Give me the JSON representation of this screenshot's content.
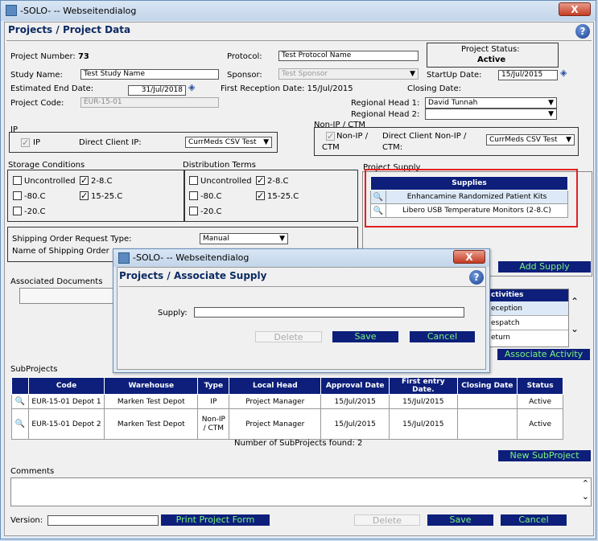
{
  "window": {
    "title": "-SOLO- -- Webseitendialog",
    "close": "X"
  },
  "page": {
    "title": "Projects / Project Data",
    "help": "?"
  },
  "project": {
    "number_label": "Project Number:",
    "number": "73",
    "protocol_label": "Protocol:",
    "protocol": "Test Protocol Name",
    "status_label": "Project Status:",
    "status": "Active",
    "study_name_label": "Study Name:",
    "study_name": "Test Study Name",
    "sponsor_label": "Sponsor:",
    "sponsor": "Test Sponsor",
    "startup_label": "StartUp Date:",
    "startup": "15/Jul/2015",
    "est_end_label": "Estimated End Date:",
    "est_end": "31/Jul/2018",
    "first_reception_label": "First Reception Date:",
    "first_reception": "15/Jul/2015",
    "closing_label": "Closing Date:",
    "code_label": "Project Code:",
    "code": "EUR-15-01",
    "regional_head1_label": "Regional Head 1:",
    "regional_head1": "David Tunnah",
    "regional_head2_label": "Regional Head 2:",
    "regional_head2": ""
  },
  "ip": {
    "section": "IP",
    "ip_label": "IP",
    "direct_client_label": "Direct Client IP:",
    "direct_client": "CurrMeds CSV Test"
  },
  "nonip": {
    "section": "Non-IP / CTM",
    "label_line1": "Non-IP /",
    "label_line2": "CTM",
    "direct_client_line1": "Direct Client Non-IP /",
    "direct_client_line2": "CTM:",
    "direct_client": "CurrMeds CSV Test"
  },
  "storage": {
    "title": "Storage Conditions",
    "options": [
      {
        "label": "Uncontrolled"
      },
      {
        "label": "2-8.C"
      },
      {
        "label": "-80.C"
      },
      {
        "label": "15-25.C"
      },
      {
        "label": "-20.C"
      }
    ]
  },
  "distribution": {
    "title": "Distribution Terms",
    "options": [
      {
        "label": "Uncontrolled"
      },
      {
        "label": "2-8.C"
      },
      {
        "label": "-80.C"
      },
      {
        "label": "15-25.C"
      },
      {
        "label": "-20.C"
      }
    ]
  },
  "shipping": {
    "type_label": "Shipping Order Request Type:",
    "type": "Manual",
    "name_label": "Name of Shipping Order"
  },
  "supply": {
    "section": "Project Supply",
    "header": "Supplies",
    "rows": [
      "Enhancamine Randomized Patient Kits",
      "Libero USB Temperature Monitors (2-8.C)"
    ],
    "add_button": "Add Supply"
  },
  "activities": {
    "header": "ctivities",
    "rows": [
      "eception",
      "espatch",
      "eturn"
    ],
    "button": "Associate Activity"
  },
  "documents": {
    "title": "Associated Documents"
  },
  "subprojects": {
    "title": "SubProjects",
    "headers": [
      "Code",
      "Warehouse",
      "Type",
      "Local Head",
      "Approval Date",
      "First entry Date.",
      "Closing Date",
      "Status"
    ],
    "rows": [
      [
        "EUR-15-01 Depot 1",
        "Marken Test Depot",
        "IP",
        "Project Manager",
        "15/Jul/2015",
        "15/Jul/2015",
        "",
        "Active"
      ],
      [
        "EUR-15-01 Depot 2",
        "Marken Test Depot",
        "Non-IP / CTM",
        "Project Manager",
        "15/Jul/2015",
        "15/Jul/2015",
        "",
        "Active"
      ]
    ],
    "count_text": "Number of SubProjects found: 2",
    "new_button": "New SubProject"
  },
  "comments": {
    "title": "Comments"
  },
  "footer": {
    "version_label": "Version:",
    "print": "Print Project Form",
    "delete": "Delete",
    "save": "Save",
    "cancel": "Cancel"
  },
  "dialog": {
    "title": "-SOLO- -- Webseitendialog",
    "close": "X",
    "page_title": "Projects / Associate Supply",
    "help": "?",
    "supply_label": "Supply:",
    "supply_value": "",
    "delete": "Delete",
    "save": "Save",
    "cancel": "Cancel"
  },
  "colors": {
    "header_blue": "#0d1f7a",
    "button_text": "#ffffff",
    "link_green": "#7cf57c",
    "highlight_red": "#e02020"
  }
}
